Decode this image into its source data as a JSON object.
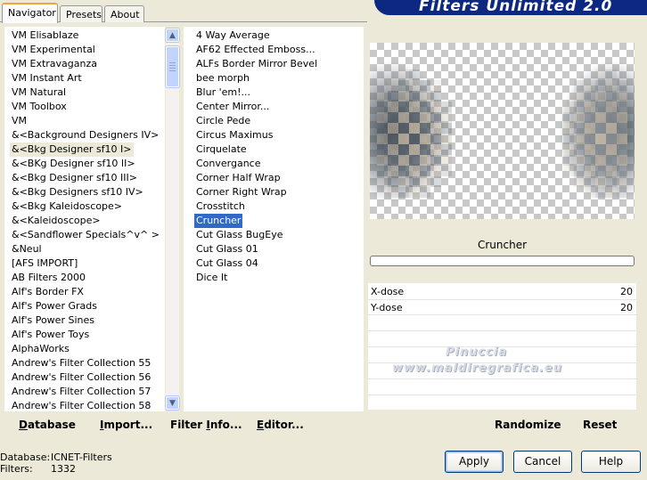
{
  "tabs": [
    {
      "label": "Navigator",
      "active": true
    },
    {
      "label": "Presets",
      "active": false
    },
    {
      "label": "About",
      "active": false
    }
  ],
  "banner": {
    "title": "Filters Unlimited 2.0",
    "color": "#0c2880"
  },
  "categories": {
    "items": [
      "VM Elisablaze",
      "VM Experimental",
      "VM Extravaganza",
      "VM Instant Art",
      "VM Natural",
      "VM Toolbox",
      "VM",
      "&<Background Designers IV>",
      "&<Bkg Designer sf10 I>",
      "&<BKg Designer sf10 II>",
      "&<Bkg Designer sf10 III>",
      "&<Bkg Designers sf10 IV>",
      "&<Bkg Kaleidoscope>",
      "&<Kaleidoscope>",
      "&<Sandflower Specials^v^ >",
      "&Neul",
      "[AFS IMPORT]",
      "AB Filters 2000",
      "Alf's Border FX",
      "Alf's Power Grads",
      "Alf's Power Sines",
      "Alf's Power Toys",
      "AlphaWorks",
      "Andrew's Filter Collection 55",
      "Andrew's Filter Collection 56",
      "Andrew's Filter Collection 57",
      "Andrew's Filter Collection 58"
    ],
    "selected_index": 8
  },
  "filters": {
    "items": [
      "4 Way Average",
      "AF62 Effected Emboss...",
      "ALFs Border Mirror Bevel",
      "bee morph",
      "Blur 'em!...",
      "Center Mirror...",
      "Circle Pede",
      "Circus Maximus",
      "Cirquelate",
      "Convergance",
      "Corner Half Wrap",
      "Corner Right Wrap",
      "Crosstitch",
      "Cruncher",
      "Cut Glass  BugEye",
      "Cut Glass 01",
      "Cut Glass 04",
      "Dice It"
    ],
    "selected_index": 13
  },
  "toolbar": {
    "database": {
      "u": "D",
      "rest": "atabase"
    },
    "import": {
      "u": "I",
      "rest": "mport..."
    },
    "filter_info": {
      "pre": "Filter ",
      "u": "I",
      "rest": "nfo..."
    },
    "editor": {
      "u": "E",
      "rest": "ditor..."
    },
    "randomize": "Randomize",
    "reset": "Reset"
  },
  "preview": {
    "filter_name": "Cruncher",
    "watermark_line1": "Pinuccia",
    "watermark_line2": "www.maldiregrafica.eu"
  },
  "params": [
    {
      "label": "X-dose",
      "value": "20"
    },
    {
      "label": "Y-dose",
      "value": "20"
    }
  ],
  "status": {
    "database_label": "Database:",
    "database_value": "ICNET-Filters",
    "filters_label": "Filters:",
    "filters_value": "1332"
  },
  "buttons": {
    "apply": "Apply",
    "cancel": "Cancel",
    "help": "Help"
  },
  "icons": {
    "scroll_up": "scroll-up-arrow-icon",
    "scroll_down": "scroll-down-arrow-icon"
  }
}
